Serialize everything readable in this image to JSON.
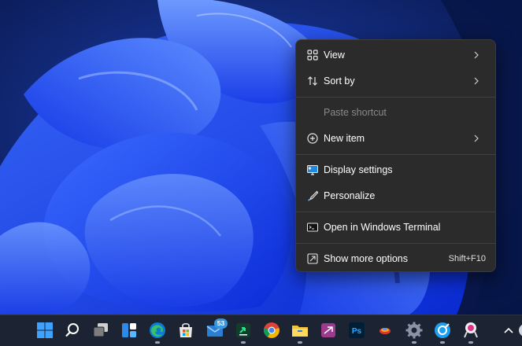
{
  "context_menu": {
    "items": [
      {
        "label": "View"
      },
      {
        "label": "Sort by"
      },
      {
        "label": "Paste shortcut",
        "disabled": true
      },
      {
        "label": "New item"
      },
      {
        "label": "Display settings"
      },
      {
        "label": "Personalize"
      },
      {
        "label": "Open in Windows Terminal"
      },
      {
        "label": "Show more options",
        "shortcut": "Shift+F10"
      }
    ]
  },
  "taskbar": {
    "mail_badge": "53",
    "icons": [
      "windows-start-icon",
      "search-icon",
      "task-view-icon",
      "widgets-icon",
      "edge-icon",
      "store-icon",
      "mail-icon",
      "slack-icon",
      "chrome-icon",
      "file-explorer-icon",
      "mixed-reality-icon",
      "photoshop-icon",
      "sticky-app-icon",
      "settings-icon",
      "browser-icon",
      "snipping-tool-icon",
      "chevron-up-icon"
    ]
  },
  "colors": {
    "menu_bg": "#2b2b2b",
    "taskbar_bg": "#1c2433",
    "wallpaper_blue": "#1a4cff",
    "accent": "#3a96dd"
  }
}
